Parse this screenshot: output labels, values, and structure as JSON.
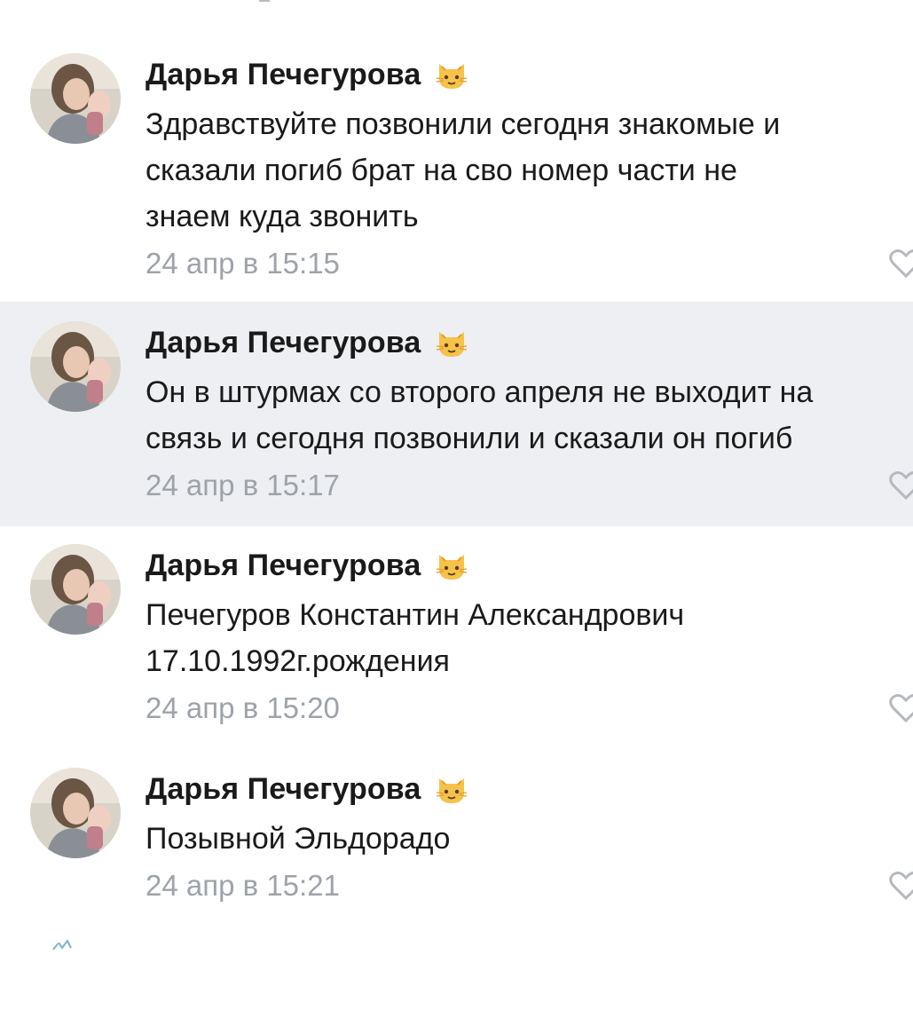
{
  "comments": [
    {
      "author": "Дарья Печегурова",
      "text": "Здравствуйте позвонили сегодня знакомые и\nсказали погиб брат на сво номер части не\nзнаем куда звонить",
      "time": "24 апр в 15:15",
      "highlighted": false
    },
    {
      "author": "Дарья Печегурова",
      "text": "Он в штурмах со второго апреля не выходит на\nсвязь и сегодня позвонили и сказали он погиб",
      "time": "24 апр в 15:17",
      "highlighted": true
    },
    {
      "author": "Дарья Печегурова",
      "text": "Печегуров Константин Александрович\n17.10.1992г.рождения",
      "time": "24 апр в 15:20",
      "highlighted": false
    },
    {
      "author": "Дарья Печегурова",
      "text": "Позывной Эльдорадо",
      "time": "24 апр в 15:21",
      "highlighted": false
    }
  ],
  "icons": {
    "author_badge": "cat-face-emoji-icon",
    "like": "heart-outline-icon"
  },
  "colors": {
    "highlight_bg": "#eeeff2",
    "timestamp": "#9ea3aa",
    "text": "#1a1a1a"
  }
}
